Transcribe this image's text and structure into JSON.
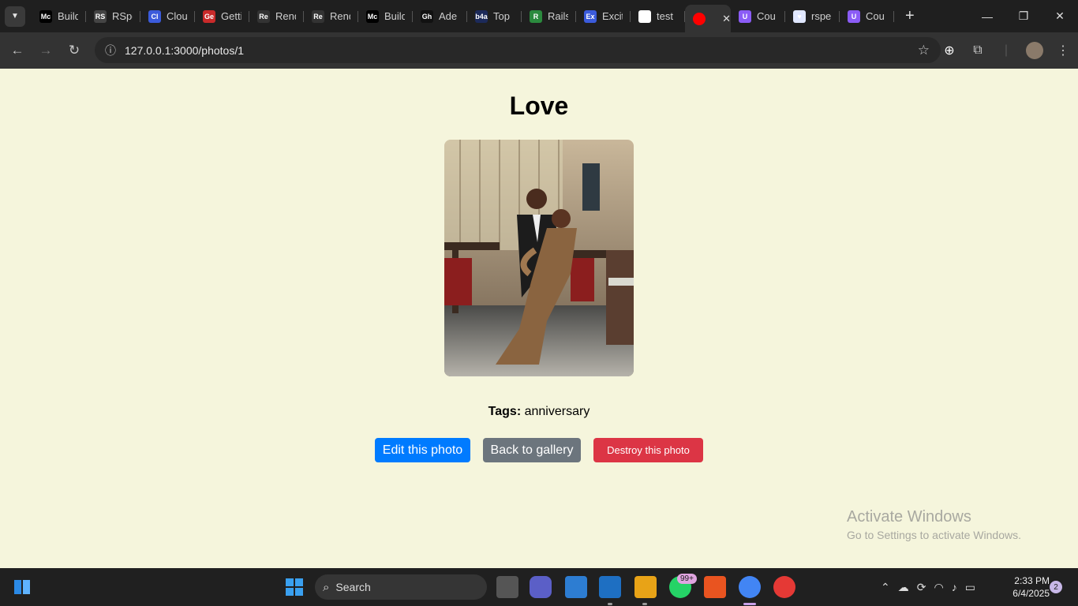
{
  "browser": {
    "tabs": [
      {
        "label": "Build",
        "favicon": "Mc",
        "color": "#000000"
      },
      {
        "label": "RSpec",
        "favicon": "RS",
        "color": "#444444"
      },
      {
        "label": "Cloud",
        "favicon": "Cl",
        "color": "#3b5bdb"
      },
      {
        "label": "Getting",
        "favicon": "Ge",
        "color": "#c92a2a"
      },
      {
        "label": "Render",
        "favicon": "Re",
        "color": "#333333"
      },
      {
        "label": "Render",
        "favicon": "Re",
        "color": "#333333"
      },
      {
        "label": "Build",
        "favicon": "Mc",
        "color": "#000000"
      },
      {
        "label": "Ade",
        "favicon": "Gh",
        "color": "#111111"
      },
      {
        "label": "Top",
        "favicon": "b4a",
        "color": "#1c2a5a"
      },
      {
        "label": "Rails",
        "favicon": "R",
        "color": "#2b8a3e"
      },
      {
        "label": "Excit",
        "favicon": "Ex",
        "color": "#3b5bdb"
      },
      {
        "label": "test",
        "favicon": "G",
        "color": "#ffffff"
      },
      {
        "label": "",
        "favicon": "",
        "color": "#ff0000",
        "active": true
      },
      {
        "label": "Cou",
        "favicon": "U",
        "color": "#8b5cf6"
      },
      {
        "label": "rspe",
        "favicon": "♥",
        "color": "#e0e7ff"
      },
      {
        "label": "Cou",
        "favicon": "U",
        "color": "#8b5cf6"
      }
    ],
    "url": "127.0.0.1:3000/photos/1"
  },
  "page": {
    "title": "Love",
    "photo_alt": "Couple portrait",
    "tags_label": "Tags:",
    "tags_value": "anniversary",
    "edit_button": "Edit this photo",
    "back_button": "Back to gallery",
    "destroy_button": "Destroy this photo"
  },
  "watermark": {
    "line1": "Activate Windows",
    "line2": "Go to Settings to activate Windows."
  },
  "taskbar": {
    "search_placeholder": "Search",
    "whatsapp_badge": "99+",
    "time": "2:33 PM",
    "date": "6/4/2025",
    "notifications": "2"
  }
}
